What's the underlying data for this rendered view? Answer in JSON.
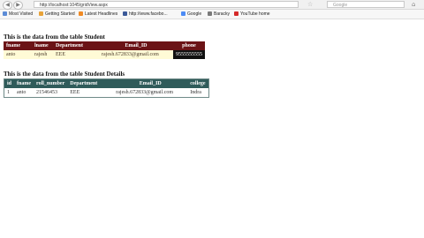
{
  "browser": {
    "url": "http://localhost:1045/gridView.aspx",
    "search_placeholder": "Google"
  },
  "bookmarks": [
    "Most Visited",
    "Getting Started",
    "Latest Headlines",
    "http://www.facebo...",
    "Google",
    "Baracky",
    "YouTube home"
  ],
  "table1": {
    "caption": "This is the data from the table Student",
    "headers": [
      "fname",
      "lname",
      "Department",
      "Email_ID",
      "phone"
    ],
    "row": [
      "anto",
      "rajesh",
      "EEE",
      "rajesh.672833@gmail.com",
      "9555555555"
    ]
  },
  "table2": {
    "caption": "This is the data from the table Student Details",
    "headers": [
      "id",
      "fname",
      "roll_number",
      "Department",
      "Email_ID",
      "college"
    ],
    "row": [
      "1",
      "anto",
      "21546453",
      "EEE",
      "rajesh.672833@gmail.com",
      "Indra"
    ]
  },
  "colors": {
    "table1_header": "#6b1316",
    "table1_row": "#fffbd6",
    "table2_header": "#2f5b5a"
  },
  "icons": [
    "back-arrow-icon",
    "forward-arrow-icon",
    "star-icon",
    "home-icon"
  ]
}
